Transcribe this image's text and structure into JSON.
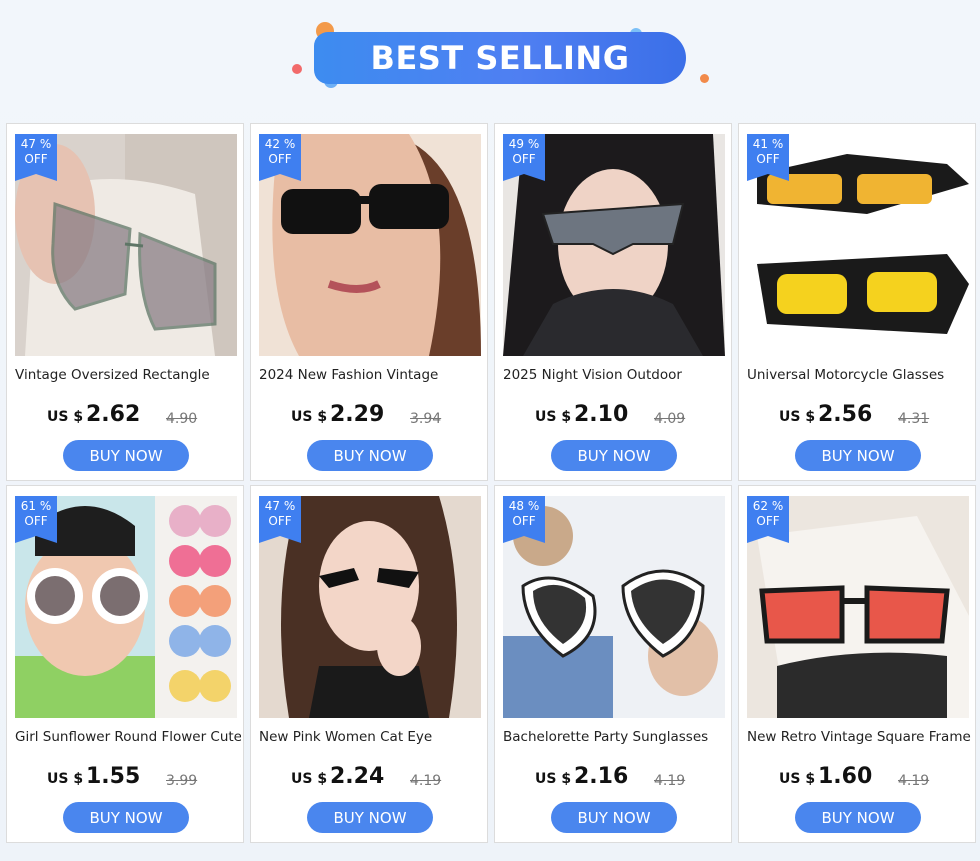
{
  "banner": {
    "title": "BEST SELLING"
  },
  "products": [
    {
      "discount": "47 %",
      "off": "OFF",
      "title": "Vintage Oversized Rectangle",
      "currency": "US $",
      "price": "2.62",
      "original": "4.90",
      "button": "BUY NOW"
    },
    {
      "discount": "42 %",
      "off": "OFF",
      "title": "2024 New Fashion Vintage",
      "currency": "US $",
      "price": "2.29",
      "original": "3.94",
      "button": "BUY NOW"
    },
    {
      "discount": "49 %",
      "off": "OFF",
      "title": "2025 Night Vision Outdoor",
      "currency": "US $",
      "price": "2.10",
      "original": "4.09",
      "button": "BUY NOW"
    },
    {
      "discount": "41 %",
      "off": "OFF",
      "title": "Universal Motorcycle Glasses",
      "currency": "US $",
      "price": "2.56",
      "original": "4.31",
      "button": "BUY NOW"
    },
    {
      "discount": "61 %",
      "off": "OFF",
      "title": "Girl Sunflower Round Flower Cute",
      "currency": "US $",
      "price": "1.55",
      "original": "3.99",
      "button": "BUY NOW"
    },
    {
      "discount": "47 %",
      "off": "OFF",
      "title": "New Pink Women Cat Eye",
      "currency": "US $",
      "price": "2.24",
      "original": "4.19",
      "button": "BUY NOW"
    },
    {
      "discount": "48 %",
      "off": "OFF",
      "title": "Bachelorette Party Sunglasses",
      "currency": "US $",
      "price": "2.16",
      "original": "4.19",
      "button": "BUY NOW"
    },
    {
      "discount": "62 %",
      "off": "OFF",
      "title": "New Retro Vintage Square Frame",
      "currency": "US $",
      "price": "1.60",
      "original": "4.19",
      "button": "BUY NOW"
    }
  ]
}
